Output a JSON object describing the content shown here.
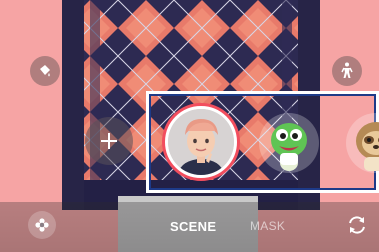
{
  "modes": {
    "active": "SCENE",
    "inactive": "MASK"
  },
  "icons": {
    "top_left": "paint-bucket-icon",
    "top_right": "person-walk-icon",
    "add": "plus-icon",
    "bottom_left": "flower-icon",
    "bottom_right": "switch-camera-icon"
  },
  "avatars": [
    {
      "name": "my-emoji",
      "selected": true
    },
    {
      "name": "green-dinosaur",
      "selected": false
    },
    {
      "name": "sloth",
      "selected": false
    }
  ],
  "colors": {
    "background": "#f6a4a4",
    "selection_ring": "#f24e5e",
    "highlight_outline": "#1d3a88"
  }
}
